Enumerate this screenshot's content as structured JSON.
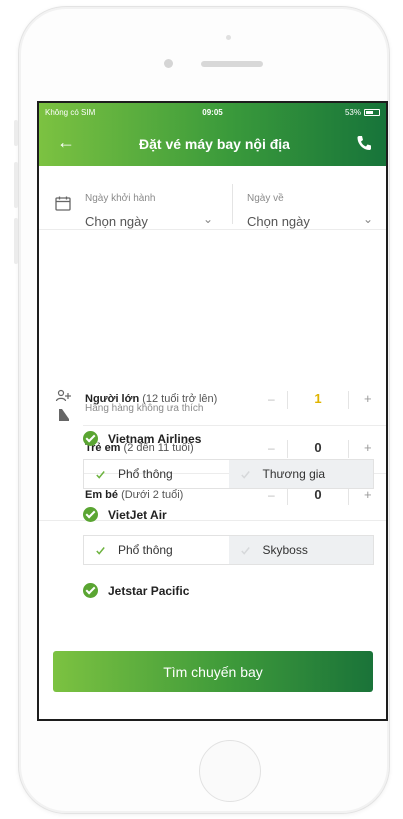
{
  "status_bar": {
    "carrier": "Không có SIM",
    "time": "09:05",
    "battery": "53%"
  },
  "header": {
    "title": "Đặt vé máy bay nội địa",
    "back_icon": "arrow-left-icon",
    "call_icon": "phone-icon",
    "gradient_start": "#7cc241",
    "gradient_end": "#17743a"
  },
  "dates": {
    "depart_label": "Ngày khởi hành",
    "depart_value": "Chọn ngày",
    "return_label": "Ngày về",
    "return_value": "Chọn ngày"
  },
  "passengers": [
    {
      "label": "Người lớn",
      "sub": " (12 tuổi trở lên)",
      "count": "1"
    },
    {
      "label": "Trẻ em",
      "sub": " (2 đến 11 tuổi)",
      "count": "0"
    },
    {
      "label": "Em bé",
      "sub": " (Dưới 2 tuổi)",
      "count": "0"
    }
  ],
  "stepper": {
    "minus": "–",
    "plus": "+"
  },
  "airlines_heading": "Hãng hàng không ưa thích",
  "airlines": [
    {
      "name": "Vietnam Airlines",
      "class_a": "Phổ thông",
      "class_b": "Thương gia"
    },
    {
      "name": "VietJet Air",
      "class_a": "Phổ thông",
      "class_b": "Skyboss"
    },
    {
      "name": "Jetstar Pacific"
    }
  ],
  "search_button": "Tìm chuyến bay",
  "colors": {
    "accent_green": "#5aa532",
    "highlight_yellow": "#e0b400"
  }
}
